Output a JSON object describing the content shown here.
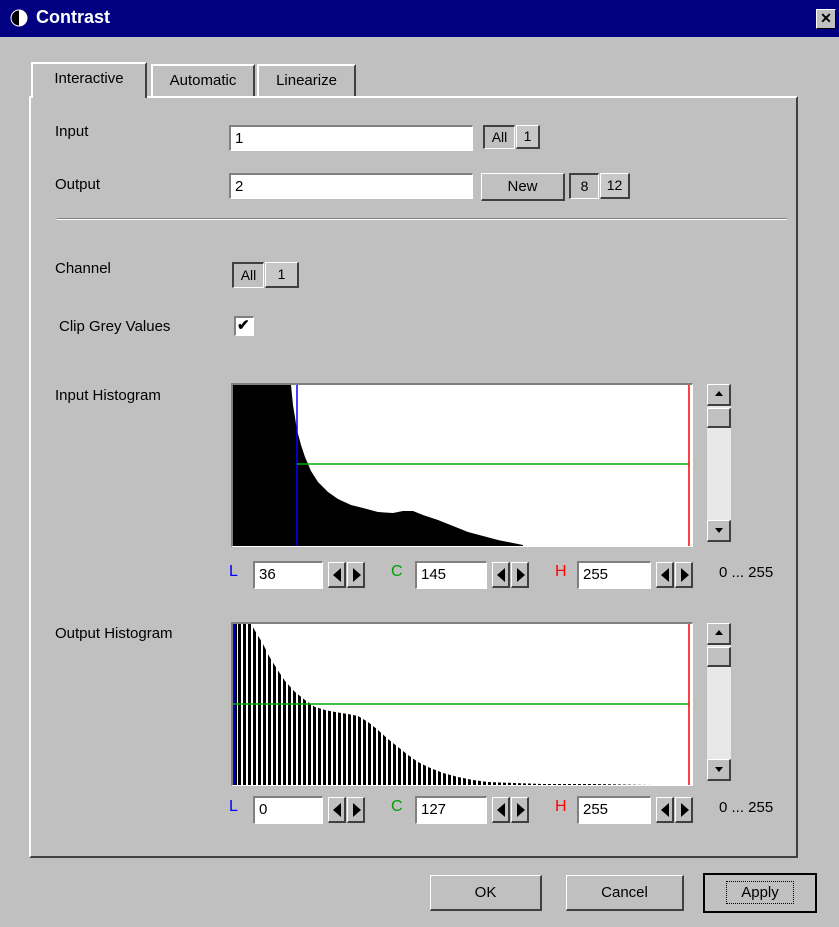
{
  "window": {
    "title": "Contrast",
    "close_glyph": "✕"
  },
  "tabs": [
    {
      "label": "Interactive",
      "active": true
    },
    {
      "label": "Automatic",
      "active": false
    },
    {
      "label": "Linearize",
      "active": false
    }
  ],
  "input": {
    "label": "Input",
    "value": "1",
    "toggle": [
      "All",
      "1"
    ],
    "selected": "All"
  },
  "output": {
    "label": "Output",
    "value": "2",
    "new_label": "New",
    "bits": [
      "8",
      "12"
    ],
    "selected_bits": "8"
  },
  "channel": {
    "label": "Channel",
    "toggle": [
      "All",
      "1"
    ],
    "selected": "All"
  },
  "clip": {
    "label": "Clip Grey Values",
    "checked": true,
    "check_glyph": "✔"
  },
  "input_histogram": {
    "label": "Input Histogram",
    "L": {
      "letter": "L",
      "value": "36",
      "color": "#0000ff"
    },
    "C": {
      "letter": "C",
      "value": "145",
      "color": "#00a000"
    },
    "H": {
      "letter": "H",
      "value": "255",
      "color": "#ff0000"
    },
    "range": "0 ... 255"
  },
  "output_histogram": {
    "label": "Output Histogram",
    "L": {
      "letter": "L",
      "value": "0",
      "color": "#0000ff"
    },
    "C": {
      "letter": "C",
      "value": "127",
      "color": "#00a000"
    },
    "H": {
      "letter": "H",
      "value": "255",
      "color": "#ff0000"
    },
    "range": "0 ... 255"
  },
  "buttons": {
    "ok": "OK",
    "cancel": "Cancel",
    "apply": "Apply"
  }
}
